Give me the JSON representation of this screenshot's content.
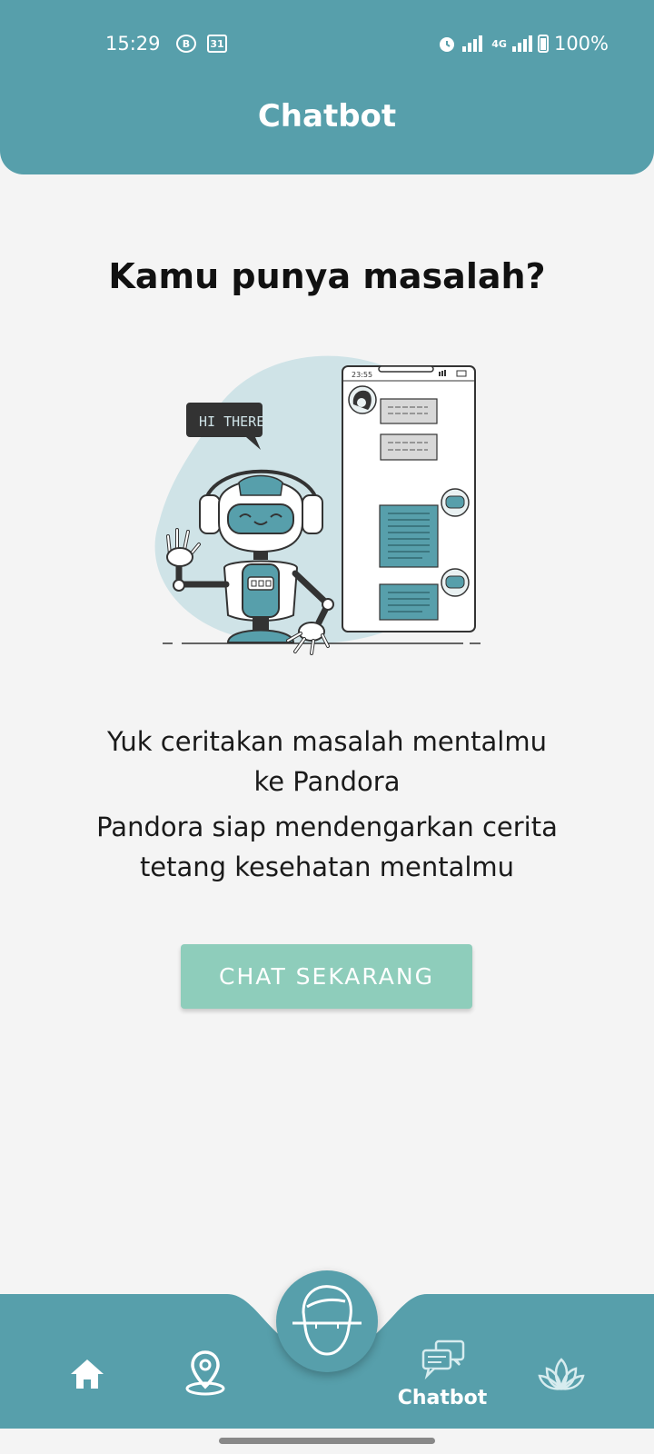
{
  "status_bar": {
    "time": "15:29",
    "notif_icon_1": "B",
    "notif_icon_2": "31",
    "network": "4G",
    "battery": "100%"
  },
  "header": {
    "title": "Chatbot"
  },
  "main": {
    "headline": "Kamu punya masalah?",
    "illustration": {
      "speech_bubble": "HI THERE!",
      "phone_time": "23:55"
    },
    "desc_line1": "Yuk ceritakan masalah mentalmu",
    "desc_line2": "ke Pandora",
    "desc_line3": "Pandora siap mendengarkan cerita",
    "desc_line4": "tetang kesehatan mentalmu",
    "cta_label": "CHAT SEKARANG"
  },
  "bottom_nav": {
    "items": [
      {
        "icon": "home-icon",
        "label": ""
      },
      {
        "icon": "map-pin-icon",
        "label": ""
      },
      {
        "icon": "face-scan-icon",
        "label": ""
      },
      {
        "icon": "chat-icon",
        "label": "Chatbot"
      },
      {
        "icon": "lotus-icon",
        "label": ""
      }
    ]
  },
  "colors": {
    "primary": "#579fab",
    "button": "#8ecdbb",
    "background": "#f4f4f4"
  }
}
